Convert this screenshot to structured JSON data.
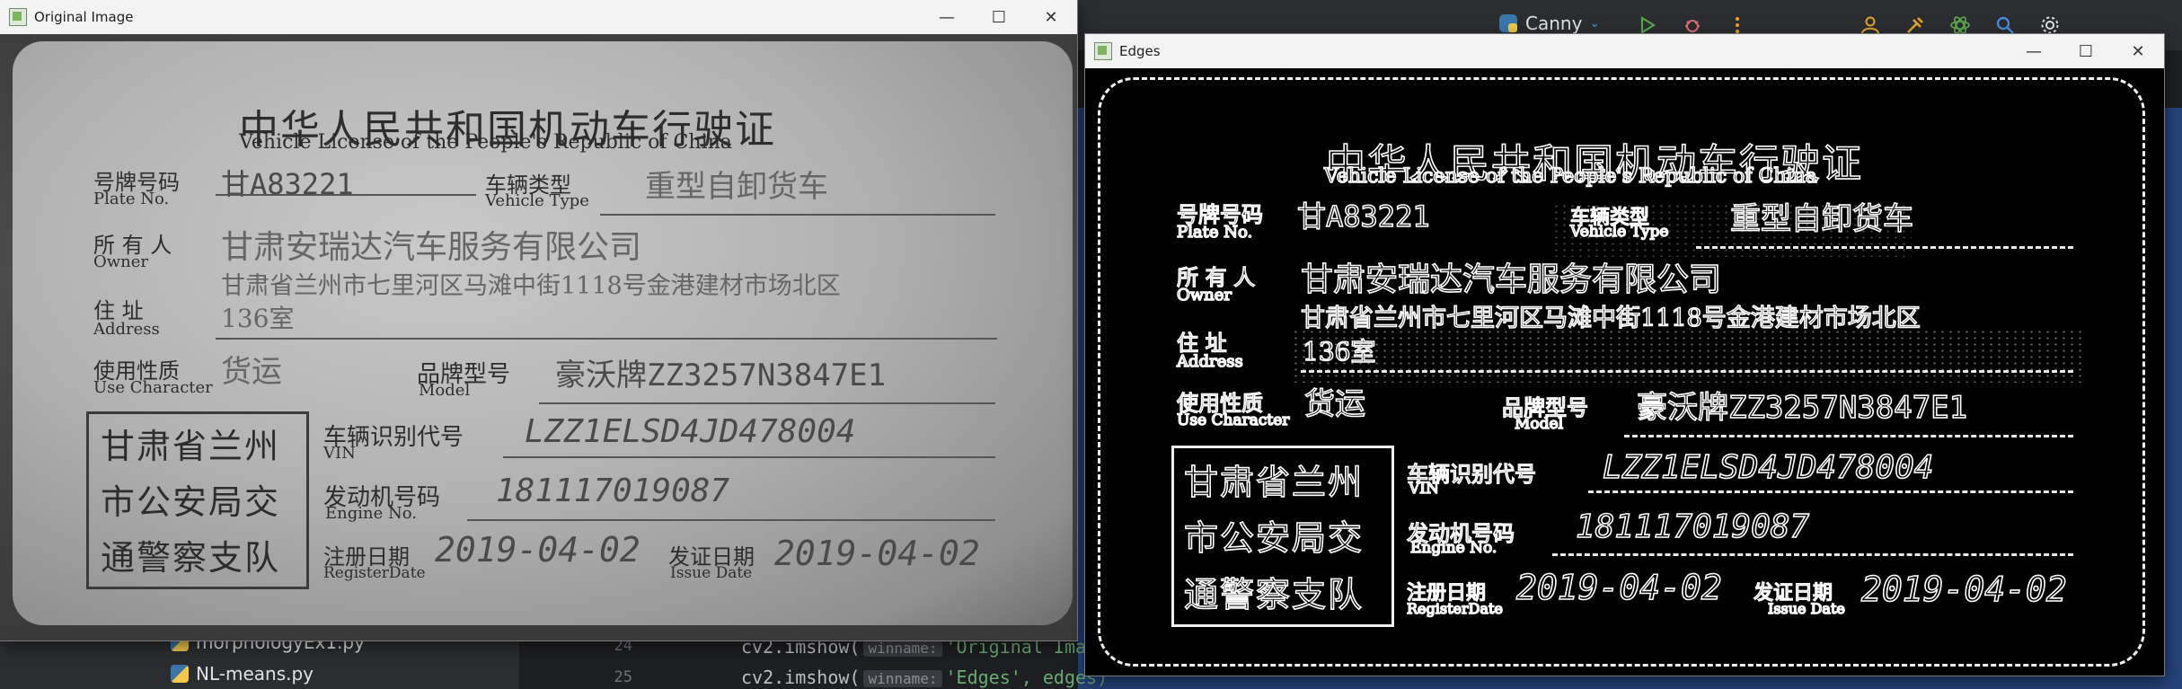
{
  "ide": {
    "run_config": "Canny",
    "tree_items": [
      "morphologyEx1.py",
      "NL-means.py"
    ],
    "line_numbers": [
      "24",
      "25"
    ],
    "code": [
      {
        "prefix": "cv2.imshow(",
        "hint": "winname:",
        "arg": "'Original Ima"
      },
      {
        "prefix": "cv2.imshow(",
        "hint": "winname:",
        "arg": "'Edges', edges)"
      }
    ],
    "colors": {
      "accent_run": "#57a64a",
      "accent_debug": "#e06c75",
      "toolbar_orange": "#e5a232"
    }
  },
  "windows": {
    "original": {
      "title": "Original Image",
      "minimize": "—",
      "maximize": "☐",
      "close": "✕"
    },
    "edges": {
      "title": "Edges",
      "minimize": "—",
      "maximize": "☐",
      "close": "✕"
    }
  },
  "license": {
    "title_cn": "中华人民共和国机动车行驶证",
    "title_en": "Vehicle License of the People's Republic of China",
    "plate_label_cn": "号牌号码",
    "plate_label_en": "Plate No.",
    "plate_value": "甘A83221",
    "type_label_cn": "车辆类型",
    "type_label_en": "Vehicle Type",
    "type_value": "重型自卸货车",
    "owner_label_cn": "所 有 人",
    "owner_label_en": "Owner",
    "owner_value": "甘肃安瑞达汽车服务有限公司",
    "address_line1": "甘肃省兰州市七里河区马滩中街1118号金港建材市场北区",
    "address_label_cn": "住 址",
    "address_label_en": "Address",
    "address_line2": "136室",
    "use_label_cn": "使用性质",
    "use_label_en": "Use Character",
    "use_value": "货运",
    "model_label_cn": "品牌型号",
    "model_label_en": "Model",
    "model_value": "豪沃牌ZZ3257N3847E1",
    "vin_label_cn": "车辆识别代号",
    "vin_label_en": "VIN",
    "vin_value": "LZZ1ELSD4JD478004",
    "engine_label_cn": "发动机号码",
    "engine_label_en": "Engine No.",
    "engine_value": "181117019087",
    "reg_label_cn": "注册日期",
    "reg_label_en": "RegisterDate",
    "reg_value": "2019-04-02",
    "issue_label_cn": "发证日期",
    "issue_label_en": "Issue Date",
    "issue_value": "2019-04-02",
    "seal_line1": "甘肃省兰州",
    "seal_line2": "市公安局交",
    "seal_line3": "通警察支队"
  }
}
